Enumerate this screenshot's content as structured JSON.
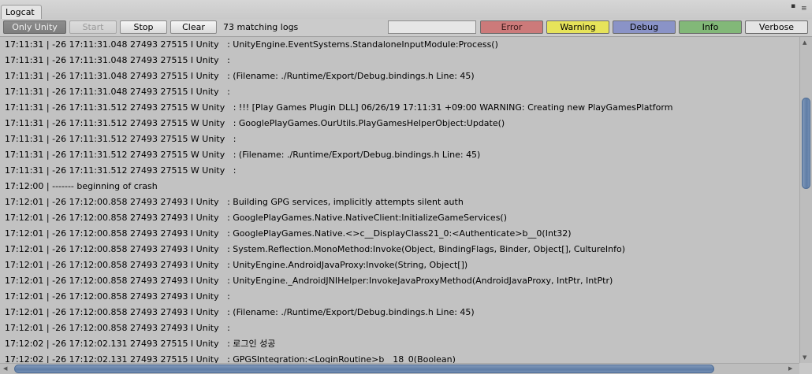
{
  "tab": {
    "title": "Logcat"
  },
  "window_controls": {
    "maximize_glyph": "▪",
    "menu_glyph": "≡"
  },
  "toolbar": {
    "only_unity": "Only Unity",
    "start": "Start",
    "stop": "Stop",
    "clear": "Clear",
    "match_count": "73 matching logs",
    "filter_value": "",
    "error": "Error",
    "warning": "Warning",
    "debug": "Debug",
    "info": "Info",
    "verbose": "Verbose"
  },
  "colors": {
    "error": "#cc7a7a",
    "warning": "#e6e35a",
    "debug": "#8a93c7",
    "info": "#82b878",
    "verbose": "#e4e4e4",
    "scroll_thumb": "#6581a9"
  },
  "scroll": {
    "vertical_position": 0.17,
    "horizontal_position": 0.0
  },
  "log_lines": [
    "17:11:31 | -26 17:11:31.048 27493 27515 I Unity   : UnityEngine.EventSystems.StandaloneInputModule:Process()",
    "17:11:31 | -26 17:11:31.048 27493 27515 I Unity   :",
    "17:11:31 | -26 17:11:31.048 27493 27515 I Unity   : (Filename: ./Runtime/Export/Debug.bindings.h Line: 45)",
    "17:11:31 | -26 17:11:31.048 27493 27515 I Unity   :",
    "17:11:31 | -26 17:11:31.512 27493 27515 W Unity   : !!! [Play Games Plugin DLL] 06/26/19 17:11:31 +09:00 WARNING: Creating new PlayGamesPlatform",
    "17:11:31 | -26 17:11:31.512 27493 27515 W Unity   : GooglePlayGames.OurUtils.PlayGamesHelperObject:Update()",
    "17:11:31 | -26 17:11:31.512 27493 27515 W Unity   :",
    "17:11:31 | -26 17:11:31.512 27493 27515 W Unity   : (Filename: ./Runtime/Export/Debug.bindings.h Line: 45)",
    "17:11:31 | -26 17:11:31.512 27493 27515 W Unity   :",
    "17:12:00 | ------- beginning of crash",
    "17:12:01 | -26 17:12:00.858 27493 27493 I Unity   : Building GPG services, implicitly attempts silent auth",
    "17:12:01 | -26 17:12:00.858 27493 27493 I Unity   : GooglePlayGames.Native.NativeClient:InitializeGameServices()",
    "17:12:01 | -26 17:12:00.858 27493 27493 I Unity   : GooglePlayGames.Native.<>c__DisplayClass21_0:<Authenticate>b__0(Int32)",
    "17:12:01 | -26 17:12:00.858 27493 27493 I Unity   : System.Reflection.MonoMethod:Invoke(Object, BindingFlags, Binder, Object[], CultureInfo)",
    "17:12:01 | -26 17:12:00.858 27493 27493 I Unity   : UnityEngine.AndroidJavaProxy:Invoke(String, Object[])",
    "17:12:01 | -26 17:12:00.858 27493 27493 I Unity   : UnityEngine._AndroidJNIHelper:InvokeJavaProxyMethod(AndroidJavaProxy, IntPtr, IntPtr)",
    "17:12:01 | -26 17:12:00.858 27493 27493 I Unity   :",
    "17:12:01 | -26 17:12:00.858 27493 27493 I Unity   : (Filename: ./Runtime/Export/Debug.bindings.h Line: 45)",
    "17:12:01 | -26 17:12:00.858 27493 27493 I Unity   :",
    "17:12:02 | -26 17:12:02.131 27493 27515 I Unity   : 로그인 성공",
    "17:12:02 | -26 17:12:02.131 27493 27515 I Unity   : GPGSIntegration:<LoginRoutine>b__18_0(Boolean)"
  ]
}
